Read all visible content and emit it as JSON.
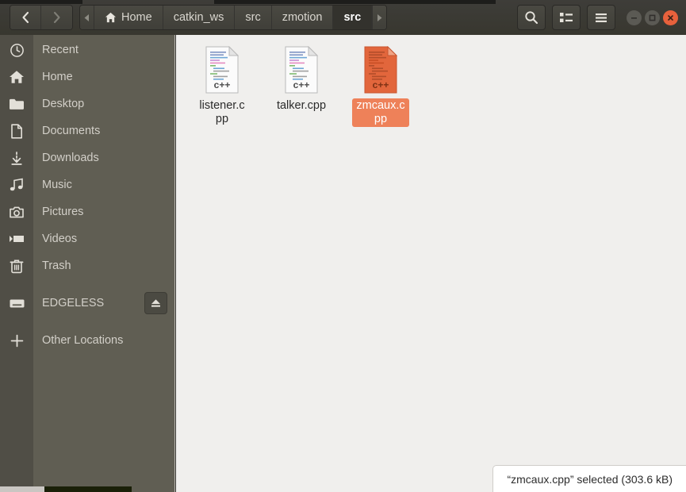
{
  "window": {
    "title": "src",
    "controls": [
      {
        "name": "minimize",
        "icon": "minimize-icon",
        "color": "#5b5a54"
      },
      {
        "name": "maximize",
        "icon": "maximize-icon",
        "color": "#5b5a54"
      },
      {
        "name": "close",
        "icon": "close-icon",
        "color": "#e8613c"
      }
    ]
  },
  "navigation": {
    "back_label": "‹",
    "forward_label": "›",
    "back_enabled": "true",
    "forward_enabled": "false"
  },
  "breadcrumb": {
    "overflow_left": "◂",
    "overflow_right": "▸",
    "items": [
      {
        "label": "Home",
        "icon": "home-icon",
        "current": "false"
      },
      {
        "label": "catkin_ws",
        "icon": "",
        "current": "false"
      },
      {
        "label": "src",
        "icon": "",
        "current": "false"
      },
      {
        "label": "zmotion",
        "icon": "",
        "current": "false"
      },
      {
        "label": "src",
        "icon": "",
        "current": "true"
      }
    ]
  },
  "toolbar": {
    "search_label": "search-icon",
    "view_toggle_label": "list-view-icon",
    "menu_label": "hamburger-menu-icon"
  },
  "sidebar": {
    "items": [
      {
        "label": "Recent",
        "icon": "clock-icon"
      },
      {
        "label": "Home",
        "icon": "home-icon"
      },
      {
        "label": "Desktop",
        "icon": "folder-icon"
      },
      {
        "label": "Documents",
        "icon": "document-icon"
      },
      {
        "label": "Downloads",
        "icon": "download-icon"
      },
      {
        "label": "Music",
        "icon": "music-note-icon"
      },
      {
        "label": "Pictures",
        "icon": "camera-icon"
      },
      {
        "label": "Videos",
        "icon": "video-camera-icon"
      },
      {
        "label": "Trash",
        "icon": "trash-icon"
      }
    ],
    "devices": [
      {
        "label": "EDGELESS",
        "icon": "drive-icon",
        "eject": "eject-icon"
      }
    ],
    "other": {
      "label": "Other Locations",
      "icon": "plus-icon"
    }
  },
  "main": {
    "files": [
      {
        "name": "listener.cpp",
        "type": "c++",
        "badge": "c++",
        "selected": "false"
      },
      {
        "name": "talker.cpp",
        "type": "c++",
        "badge": "c++",
        "selected": "false"
      },
      {
        "name": "zmcaux.cpp",
        "type": "c++",
        "badge": "c++",
        "selected": "true"
      }
    ]
  },
  "statusbar": {
    "text": "“zmcaux.cpp” selected  (303.6 kB)"
  },
  "colors": {
    "accent": "#ee8159",
    "close_button": "#e8613c",
    "titlebar": "#3e3d39",
    "sidebar": "#605e53",
    "content": "#f0efed"
  }
}
